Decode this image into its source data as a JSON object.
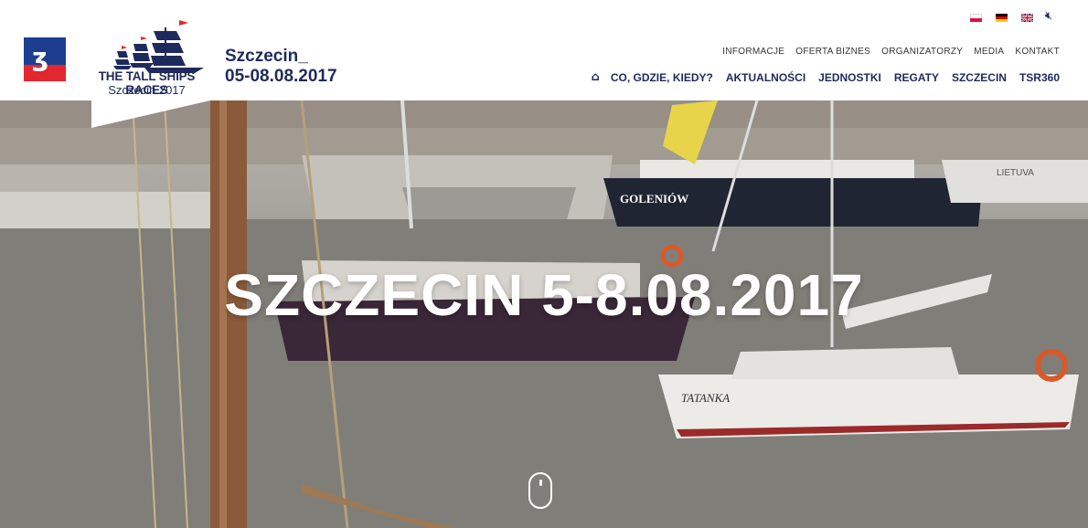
{
  "header": {
    "logo_title": "THE TALL SHIPS RACES",
    "logo_subtitle": "Szczecin 2017",
    "event_city": "Szczecin_",
    "event_dates": "05-08.08.2017"
  },
  "languages": [
    {
      "code": "pl",
      "icon": "poland-flag-icon"
    },
    {
      "code": "de",
      "icon": "germany-flag-icon"
    },
    {
      "code": "en",
      "icon": "uk-flag-icon"
    }
  ],
  "mute_icon": "speaker-muted-icon",
  "top_nav": [
    "INFORMACJE",
    "OFERTA BIZNES",
    "ORGANIZATORZY",
    "MEDIA",
    "KONTAKT"
  ],
  "main_nav": [
    "CO, GDZIE, KIEDY?",
    "AKTUALNOŚCI",
    "JEDNOSTKI",
    "REGATY",
    "SZCZECIN",
    "TSR360"
  ],
  "hero": {
    "title": "SZCZECIN 5-8.08.2017",
    "boat_names": [
      "GOLENIÓW",
      "TATANKA",
      "LIETUVA"
    ]
  },
  "colors": {
    "brand_navy": "#1f2a5c",
    "city_blue": "#1e3d8f",
    "city_red": "#e2282e"
  }
}
